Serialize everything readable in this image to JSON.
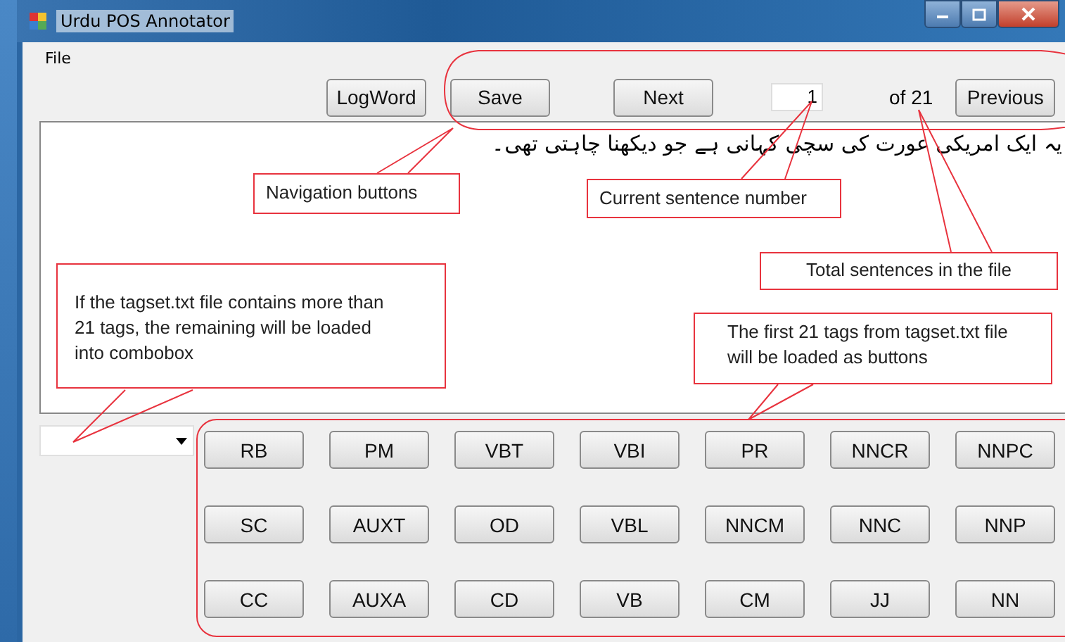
{
  "window": {
    "title": "Urdu POS Annotator"
  },
  "menu": [
    "File"
  ],
  "toolbar": {
    "buttons": [
      "LogWord",
      "Save",
      "Next"
    ],
    "sentence_number": "1",
    "total": "of 21",
    "previous": "Previous"
  },
  "sentence": "یہ ایک امریکی عورت کی سچی کہانی ہے جو دیکھنا چاہتی تھی۔",
  "tags": [
    "RB",
    "PM",
    "VBT",
    "VBI",
    "PR",
    "NNCR",
    "NNPC",
    "SC",
    "AUXT",
    "OD",
    "VBL",
    "NNCM",
    "NNC",
    "NNP",
    "CC",
    "AUXA",
    "CD",
    "VB",
    "CM",
    "JJ",
    "NN"
  ],
  "annotations": [
    {
      "kind": "navigation",
      "text": "Navigation buttons"
    },
    {
      "kind": "current",
      "text": "Current sentence number"
    },
    {
      "kind": "total",
      "text": "Total sentences in the file"
    },
    {
      "kind": "combobox",
      "text": "If the tagset.txt file contains more than 21 tags, the remaining will be loaded into combobox"
    },
    {
      "kind": "buttons",
      "text": "The first 21 tags from tagset.txt file will be loaded as buttons"
    }
  ]
}
